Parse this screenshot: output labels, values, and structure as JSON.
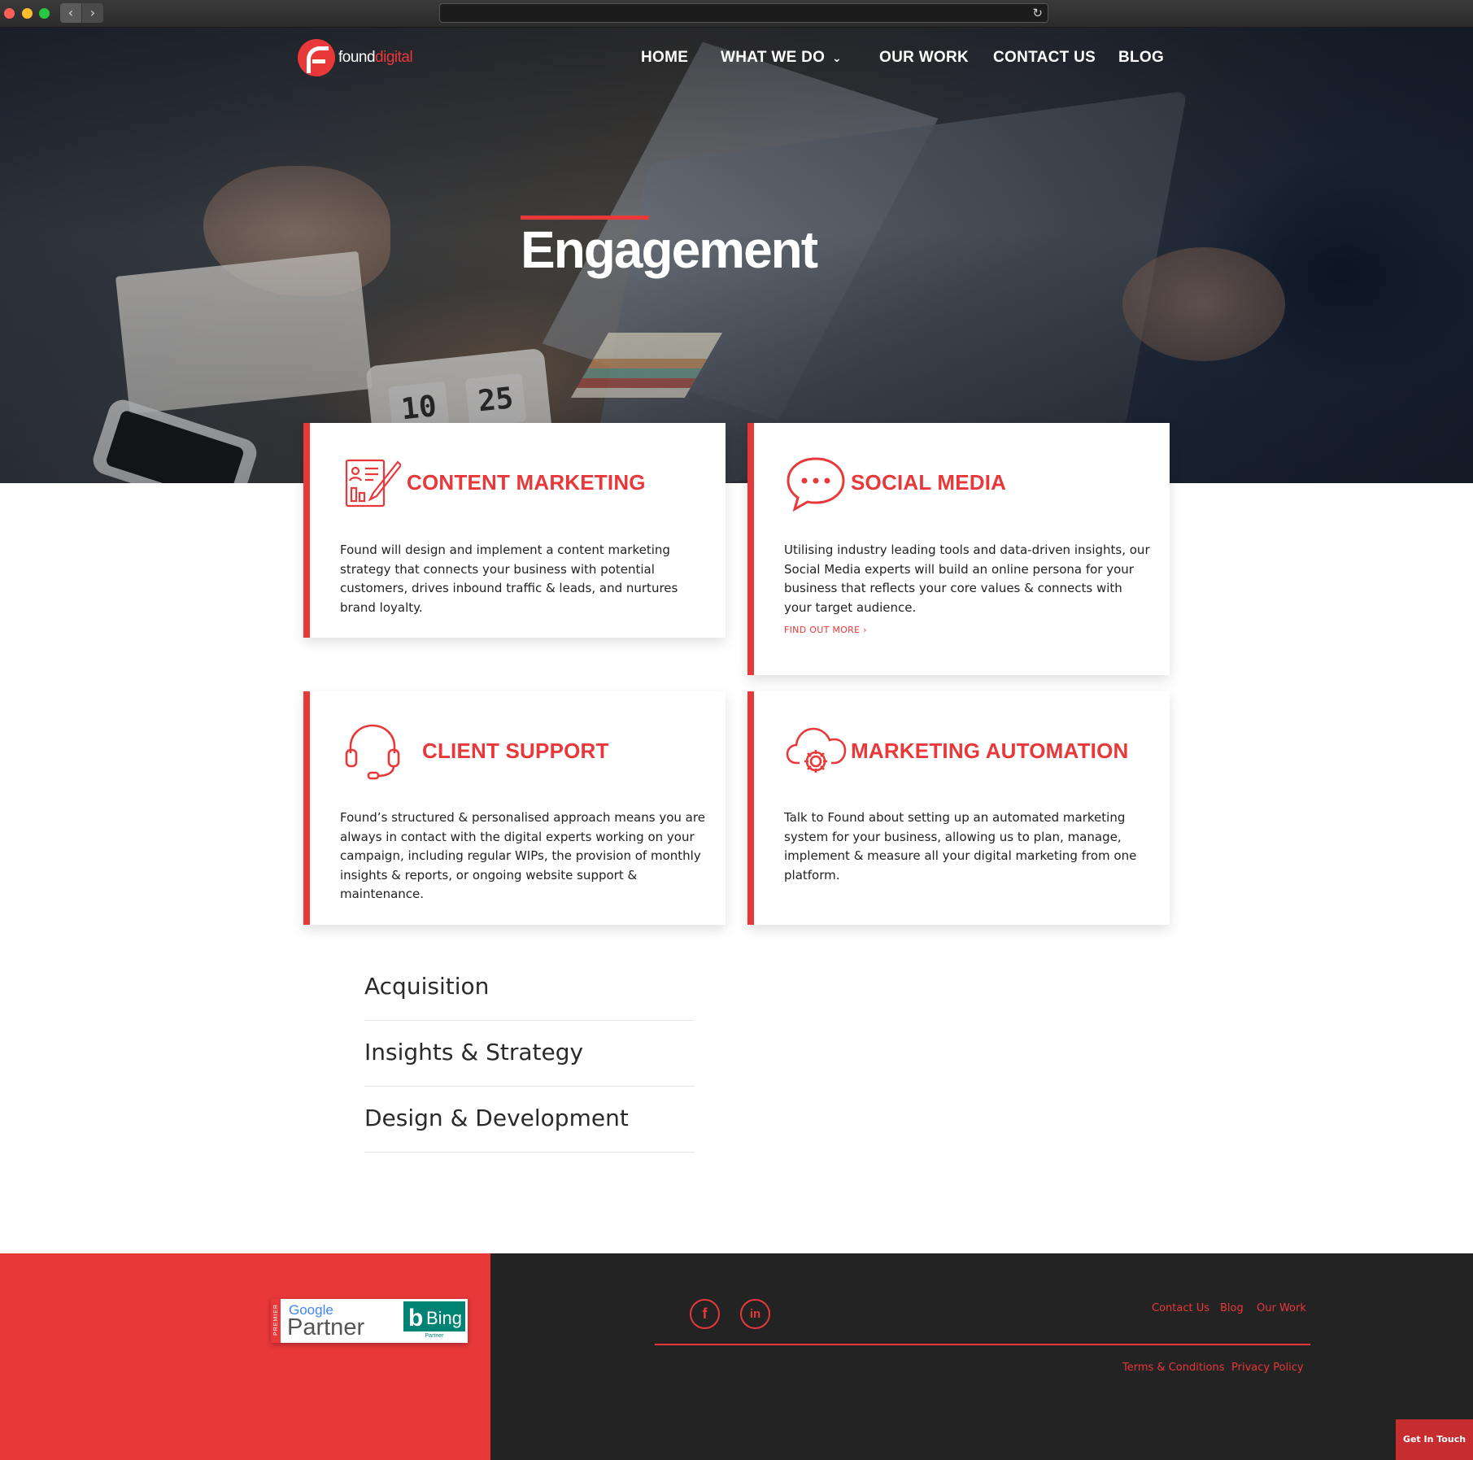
{
  "browser": {
    "back_label": "‹",
    "forward_label": "›",
    "reload_icon": "reload-icon"
  },
  "header": {
    "logo_main": "found",
    "logo_sub": "digital",
    "nav": [
      "HOME",
      "WHAT WE DO",
      "OUR WORK",
      "CONTACT US",
      "BLOG"
    ],
    "dropdown_icon": "chevron-down-icon"
  },
  "hero": {
    "title": "Engagement"
  },
  "cards": [
    {
      "title": "CONTENT MARKETING",
      "icon": "content-report-icon",
      "body": "Found will design and implement a content marketing strategy that connects your business with potential customers, drives inbound traffic & leads, and nurtures brand loyalty."
    },
    {
      "title": "SOCIAL MEDIA",
      "icon": "chat-bubble-icon",
      "body": "Utilising industry leading tools and data-driven insights, our Social Media experts will build an online persona for your business that reflects your core values & connects with your target audience.",
      "link": "FIND OUT MORE ›"
    },
    {
      "title": "CLIENT SUPPORT",
      "icon": "headset-icon",
      "body": "Found’s structured & personalised approach means you are always in contact with the digital experts working on your campaign, including regular WIPs, the provision of monthly insights & reports, or ongoing website support & maintenance."
    },
    {
      "title": "MARKETING AUTOMATION",
      "icon": "cloud-gear-icon",
      "body": "Talk to Found about setting up an automated marketing system for your business, allowing us to plan, manage, implement & measure all your digital marketing from one platform."
    }
  ],
  "services": [
    "Acquisition",
    "Insights & Strategy",
    "Design & Development"
  ],
  "footer": {
    "badges": {
      "premier": "PREMIER",
      "google": "Google",
      "partner": "Partner",
      "bing": "Bing",
      "bing_partner": "Partner"
    },
    "social": [
      {
        "icon": "facebook-icon",
        "glyph": "f"
      },
      {
        "icon": "linkedin-icon",
        "glyph": "in"
      }
    ],
    "links": [
      "Contact Us",
      "Blog",
      "Our Work"
    ],
    "legal": [
      "Terms  & Conditions",
      "Privacy Policy"
    ],
    "cta": "Get In Touch"
  },
  "colors": {
    "accent": "#e8383a",
    "dark": "#232323",
    "bing": "#008373"
  }
}
